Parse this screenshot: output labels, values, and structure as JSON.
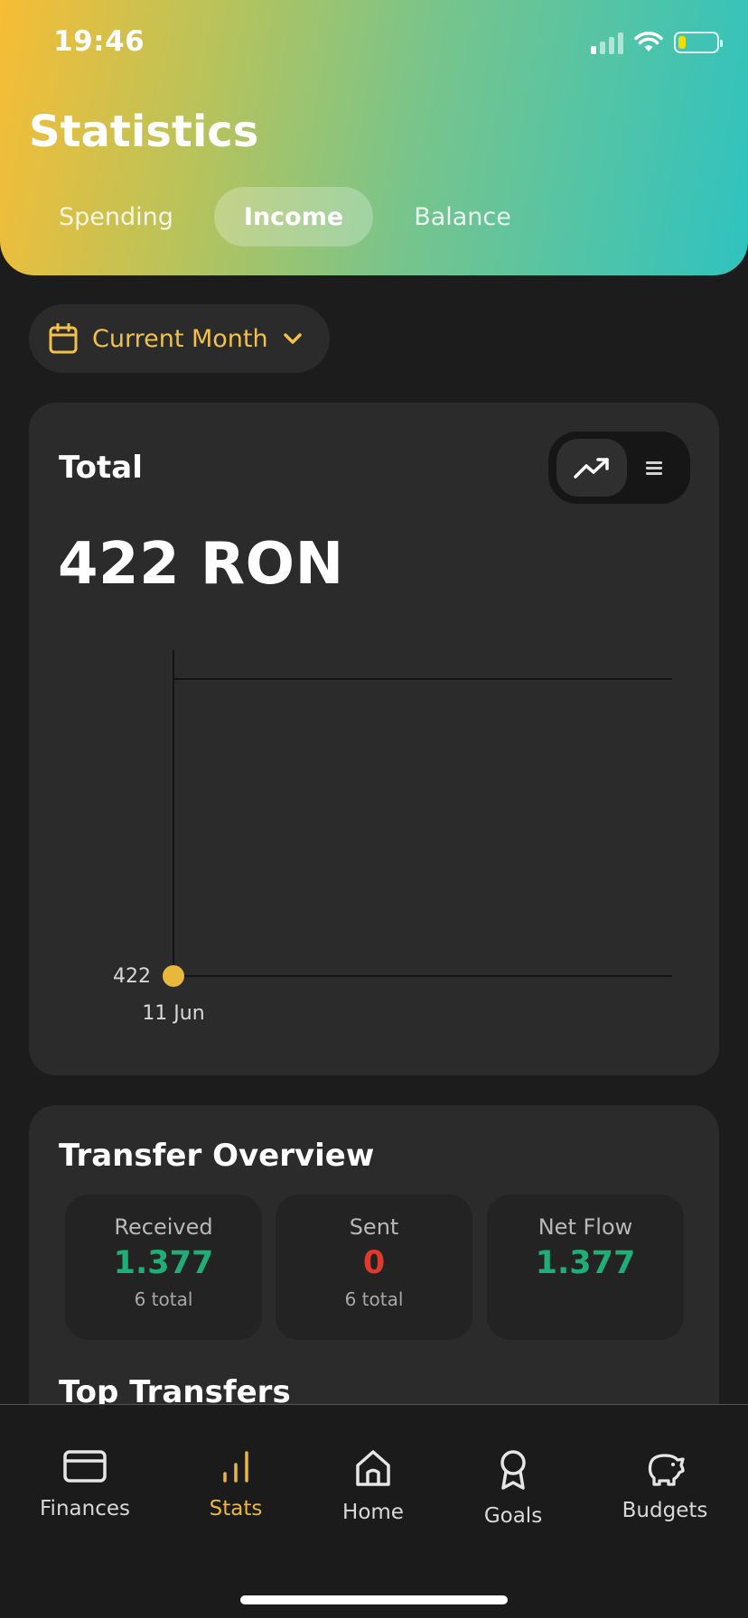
{
  "status_bar": {
    "time": "19:46"
  },
  "header": {
    "title": "Statistics",
    "tabs": [
      {
        "label": "Spending",
        "active": false
      },
      {
        "label": "Income",
        "active": true
      },
      {
        "label": "Balance",
        "active": false
      }
    ]
  },
  "period_selector": {
    "label": "Current Month"
  },
  "total_card": {
    "title": "Total",
    "amount": "422 RON",
    "view_toggle": {
      "selected": "chart"
    }
  },
  "chart_data": {
    "type": "line",
    "x": [
      "11 Jun"
    ],
    "series": [
      {
        "values": [
          422
        ]
      }
    ],
    "y_tick_labels": [
      "422"
    ],
    "x_tick_labels": [
      "11 Jun"
    ],
    "point_color": "#e7b83c",
    "grid": true
  },
  "transfer_overview": {
    "title": "Transfer Overview",
    "stats": [
      {
        "label": "Received",
        "value": "1.377",
        "sub": "6 total",
        "color": "#1fae78"
      },
      {
        "label": "Sent",
        "value": "0",
        "sub": "6 total",
        "color": "#e03a2f"
      },
      {
        "label": "Net Flow",
        "value": "1.377",
        "sub": "",
        "color": "#1fae78"
      }
    ]
  },
  "top_transfers": {
    "title": "Top Transfers"
  },
  "tab_bar": {
    "items": [
      {
        "label": "Finances",
        "icon": "card-icon",
        "active": false
      },
      {
        "label": "Stats",
        "icon": "bar-chart-icon",
        "active": true
      },
      {
        "label": "Home",
        "icon": "home-icon",
        "active": false
      },
      {
        "label": "Goals",
        "icon": "award-icon",
        "active": false
      },
      {
        "label": "Budgets",
        "icon": "piggy-bank-icon",
        "active": false
      }
    ]
  },
  "colors": {
    "accent": "#e7b83c",
    "positive": "#1fae78",
    "negative": "#e03a2f"
  }
}
